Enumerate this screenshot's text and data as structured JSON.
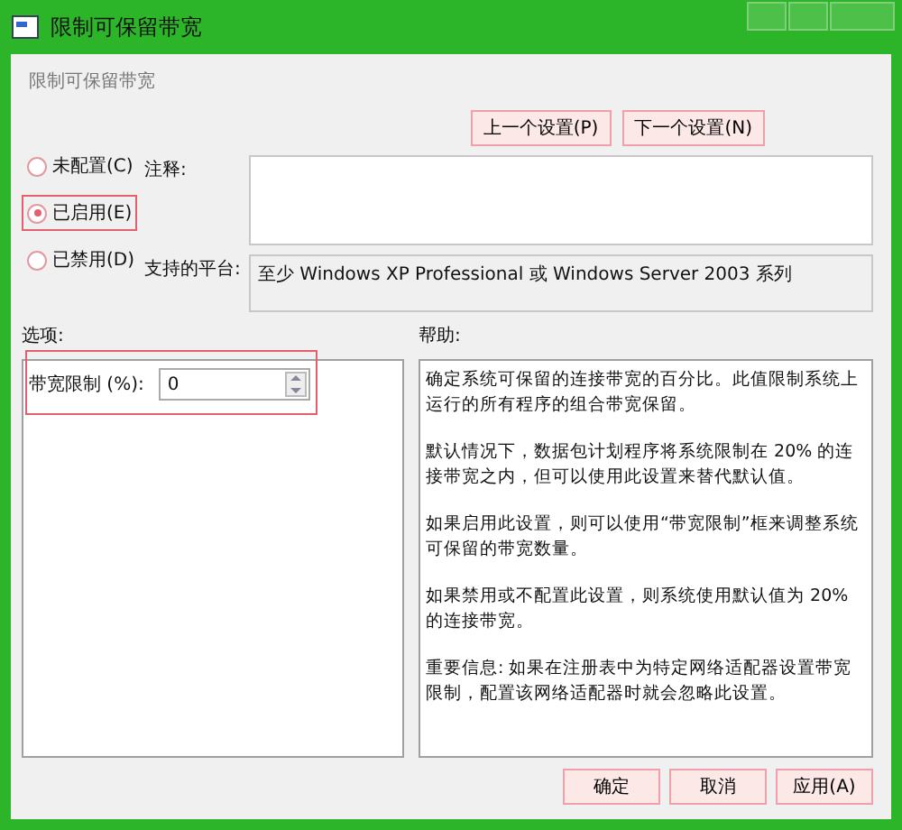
{
  "window": {
    "title": "限制可保留带宽"
  },
  "header": {
    "title": "限制可保留带宽"
  },
  "nav_buttons": [
    "上一个设置(P)",
    "下一个设置(N)"
  ],
  "states": [
    {
      "label": "未配置(C)",
      "selected": false,
      "highlighted": false
    },
    {
      "label": "已启用(E)",
      "selected": true,
      "highlighted": true
    },
    {
      "label": "已禁用(D)",
      "selected": false,
      "highlighted": false
    }
  ],
  "comment": {
    "label": "注释:"
  },
  "platform": {
    "label": "支持的平台:",
    "value": "至少 Windows XP Professional 或 Windows Server 2003 系列"
  },
  "options": {
    "label": "选项:",
    "field_label": "带宽限制 (%):",
    "value": "0",
    "highlighted": true
  },
  "help": {
    "label": "帮助:",
    "paragraphs": [
      "确定系统可保留的连接带宽的百分比。此值限制系统上运行的所有程序的组合带宽保留。",
      "默认情况下，数据包计划程序将系统限制在 20% 的连接带宽之内，但可以使用此设置来替代默认值。",
      "如果启用此设置，则可以使用“带宽限制”框来调整系统可保留的带宽数量。",
      "如果禁用或不配置此设置，则系统使用默认值为 20% 的连接带宽。",
      "重要信息: 如果在注册表中为特定网络适配器设置带宽限制，配置该网络适配器时就会忽略此设置。"
    ]
  },
  "footer_buttons": [
    "确定",
    "取消",
    "应用(A)"
  ]
}
